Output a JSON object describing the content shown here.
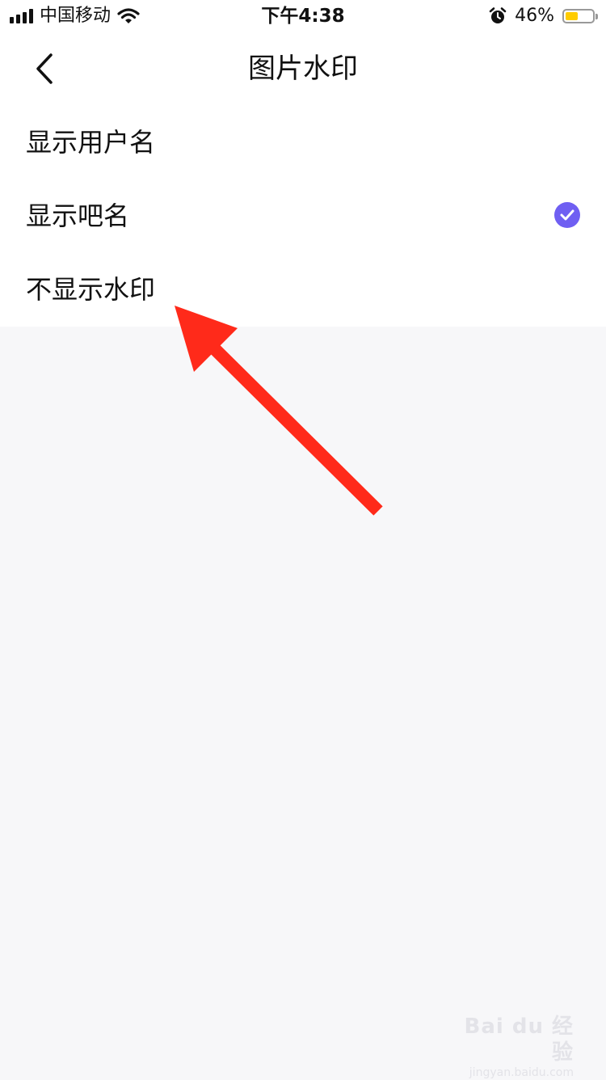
{
  "status_bar": {
    "carrier": "中国移动",
    "time": "下午4:38",
    "battery_percent": "46%",
    "battery_level": 0.46,
    "icons": [
      "signal-icon",
      "wifi-icon",
      "alarm-icon",
      "battery-icon"
    ]
  },
  "nav": {
    "title": "图片水印",
    "back_icon": "chevron-left-icon"
  },
  "options": [
    {
      "label": "显示用户名",
      "selected": false
    },
    {
      "label": "显示吧名",
      "selected": true
    },
    {
      "label": "不显示水印",
      "selected": false
    }
  ],
  "colors": {
    "accent": "#6f5ff2",
    "annotation_arrow": "#ff2a1a",
    "background": "#f7f7f9",
    "battery": "#ffcc00"
  },
  "watermark": {
    "brand": "Bai du 经验",
    "site": "jingyan.baidu.com"
  }
}
